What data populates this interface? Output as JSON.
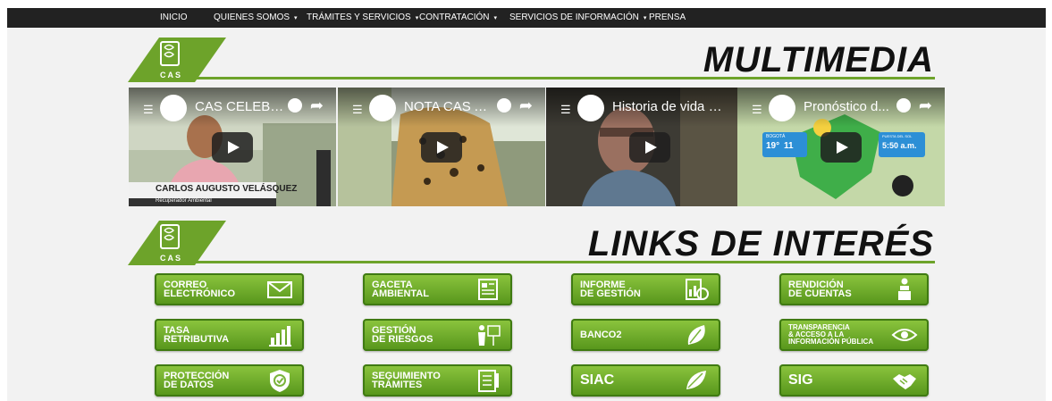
{
  "nav": {
    "items": [
      {
        "label": "INICIO",
        "dropdown": false
      },
      {
        "label": "QUIENES SOMOS",
        "dropdown": true
      },
      {
        "label": "TRÁMITES Y SERVICIOS",
        "dropdown": true
      },
      {
        "label": "CONTRATACIÓN",
        "dropdown": true
      },
      {
        "label": "SERVICIOS DE INFORMACIÓN",
        "dropdown": true
      },
      {
        "label": "PRENSA",
        "dropdown": false
      }
    ],
    "caret": "▾"
  },
  "logo_text": "CAS",
  "multimedia": {
    "heading": "MULTIMEDIA",
    "videos": [
      {
        "title": "CAS CELEBR...",
        "lower_third_name": "CARLOS AUGUSTO VELÁSQUEZ",
        "lower_third_role": "Recuperador Ambiental"
      },
      {
        "title": "NOTA CAS A..."
      },
      {
        "title": "Historia de vida de..."
      },
      {
        "title": "Pronóstico d...",
        "weather": {
          "city": "BOGOTÁ",
          "temp_hi": "19°",
          "temp_lo": "11",
          "sunset_label": "PUESTA DEL SOL",
          "sunset_time": "5:50 a.m."
        }
      }
    ]
  },
  "links": {
    "heading": "LINKS DE INTERÉS",
    "buttons": [
      {
        "label": "CORREO\nELECTRÓNICO",
        "icon": "envelope-icon"
      },
      {
        "label": "GACETA\nAMBIENTAL",
        "icon": "newspaper-icon"
      },
      {
        "label": "INFORME\nDE GESTIÓN",
        "icon": "report-chart-icon"
      },
      {
        "label": "RENDICIÓN\nDE CUENTAS",
        "icon": "speaker-podium-icon"
      },
      {
        "label": "TASA\nRETRIBUTIVA",
        "icon": "bar-chart-icon"
      },
      {
        "label": "GESTIÓN\nDE RIESGOS",
        "icon": "presenter-icon"
      },
      {
        "label": "BanCO2",
        "icon": "leaf-icon"
      },
      {
        "label": "TRANSPARENCIA\n& ACCESO A LA\nINFORMACIÓN PÚBLICA",
        "icon": "eye-icon"
      },
      {
        "label": "PROTECCIÓN\nDE DATOS",
        "icon": "shield-check-icon"
      },
      {
        "label": "SEGUIMIENTO\nTRÁMITES",
        "icon": "checklist-icon"
      },
      {
        "label": "SIAC",
        "icon": "leaves-icon"
      },
      {
        "label": "SIG",
        "icon": "handshake-icon"
      }
    ]
  },
  "colors": {
    "accent_green": "#6da32a",
    "button_green": "#7ab43a",
    "navbar": "#222222"
  }
}
